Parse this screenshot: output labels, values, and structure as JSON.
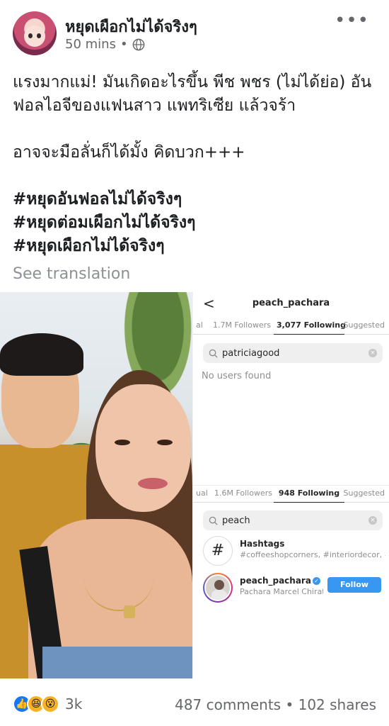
{
  "post": {
    "page_name": "หยุดเผือกไม่ได้จริงๆ",
    "time": "50 mins",
    "separator": "•",
    "privacy_icon": "globe-icon",
    "more_icon": "more-options-icon",
    "more_label": "•••",
    "text_lines": [
      "แรงมากแม่! มันเกิดอะไรขึ้น พีช พชร (ไม่ได้ย่อ) อัน",
      "ฟอลไอจีของแฟนสาว แพทริเซีย แล้วจร้า",
      "อาจจะมือลั่นก็ได้มั้ง คิดบวก+++"
    ],
    "hashtags": [
      "#หยุดอันฟอลไม่ได้จริงๆ",
      "#หยุดต่อมเผือกไม่ได้จริงๆ",
      "#หยุดเผือกไม่ได้จริงๆ"
    ],
    "see_translation": "See translation"
  },
  "instagram": {
    "back_icon": "back-arrow-icon",
    "back_label": "<",
    "username": "peach_pachara",
    "panel1": {
      "tabs": [
        "al",
        "1.7M Followers",
        "3,077 Following",
        "Suggested"
      ],
      "active_tab": 2,
      "search_value": "patriciagood",
      "no_result": "No users found"
    },
    "panel2": {
      "tabs": [
        "ual",
        "1.6M Followers",
        "948 Following",
        "Suggested"
      ],
      "active_tab": 2,
      "search_value": "peach",
      "results": [
        {
          "title": "Hashtags",
          "subtitle": "#coffeeshopcorners, #interiordecor, #int...",
          "icon": "hashtag-icon",
          "symbol": "#"
        },
        {
          "title": "peach_pachara",
          "subtitle": "Pachara Marcel Chirat...",
          "verified": true,
          "follow_label": "Follow"
        }
      ]
    },
    "search_icon": "search-icon",
    "clear_icon": "clear-icon",
    "clear_symbol": "×",
    "verified_symbol": "✓"
  },
  "footer": {
    "reactions": [
      "like-icon",
      "haha-icon",
      "wow-icon"
    ],
    "reaction_symbols": [
      "👍",
      "😆",
      "😮"
    ],
    "reaction_count": "3k",
    "comments": "487 comments",
    "dot": "•",
    "shares": "102 shares"
  }
}
